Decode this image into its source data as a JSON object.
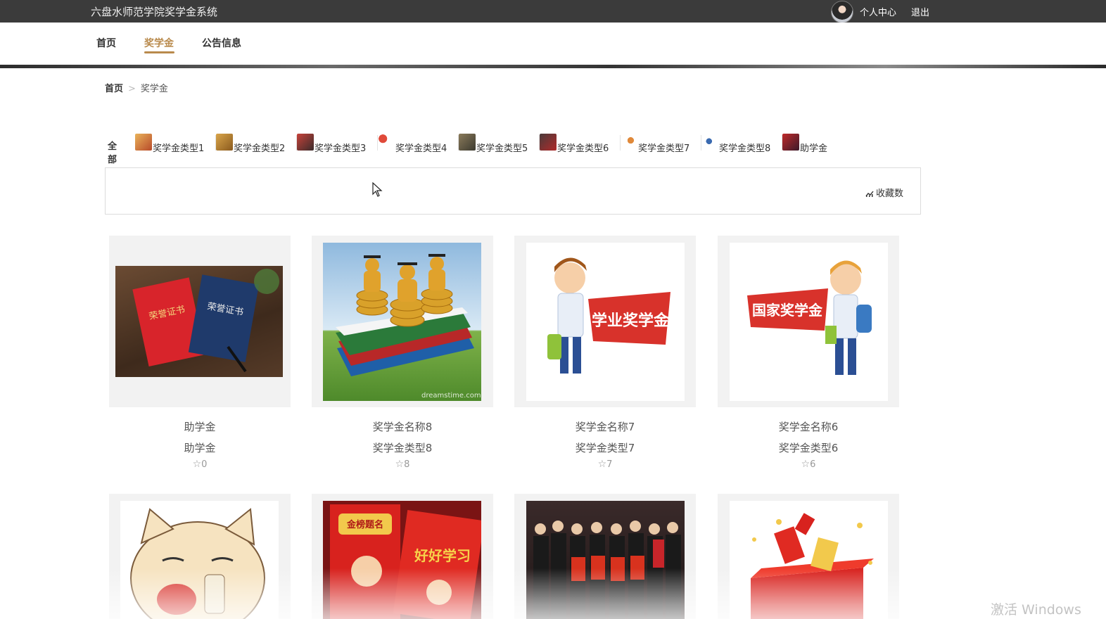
{
  "topbar": {
    "title": "六盘水师范学院奖学金系统",
    "user_center": "个人中心",
    "logout": "退出"
  },
  "nav": {
    "items": [
      "首页",
      "奖学金",
      "公告信息"
    ],
    "active": "奖学金",
    "accent": "#b98a4c"
  },
  "breadcrumb": {
    "home": "首页",
    "separator": ">",
    "current": "奖学金"
  },
  "categories": {
    "all": "全部",
    "items": [
      "奖学金类型1",
      "奖学金类型2",
      "奖学金类型3",
      "奖学金类型4",
      "奖学金类型5",
      "奖学金类型6",
      "奖学金类型7",
      "奖学金类型8",
      "助学金"
    ]
  },
  "sort": {
    "label": "收藏数"
  },
  "cards": [
    {
      "name": "助学金",
      "type": "助学金",
      "favorites": "0"
    },
    {
      "name": "奖学金名称8",
      "type": "奖学金类型8",
      "favorites": "8"
    },
    {
      "name": "奖学金名称7",
      "type": "奖学金类型7",
      "favorites": "7"
    },
    {
      "name": "奖学金名称6",
      "type": "奖学金类型6",
      "favorites": "6"
    },
    {
      "name": "",
      "type": "",
      "favorites": ""
    },
    {
      "name": "",
      "type": "",
      "favorites": ""
    },
    {
      "name": "",
      "type": "",
      "favorites": ""
    },
    {
      "name": "",
      "type": "",
      "favorites": ""
    }
  ],
  "images": {
    "card1_text_left": "荣誉证书",
    "card1_text_right": "荣誉证书",
    "card3_banner": "学业奖学金",
    "card4_banner": "国家奖学金",
    "card2_watermark": "dreamstime.com",
    "card6_text_left": "金榜题名",
    "card6_text_right": "好好学习"
  },
  "watermark": "激活 Windows"
}
